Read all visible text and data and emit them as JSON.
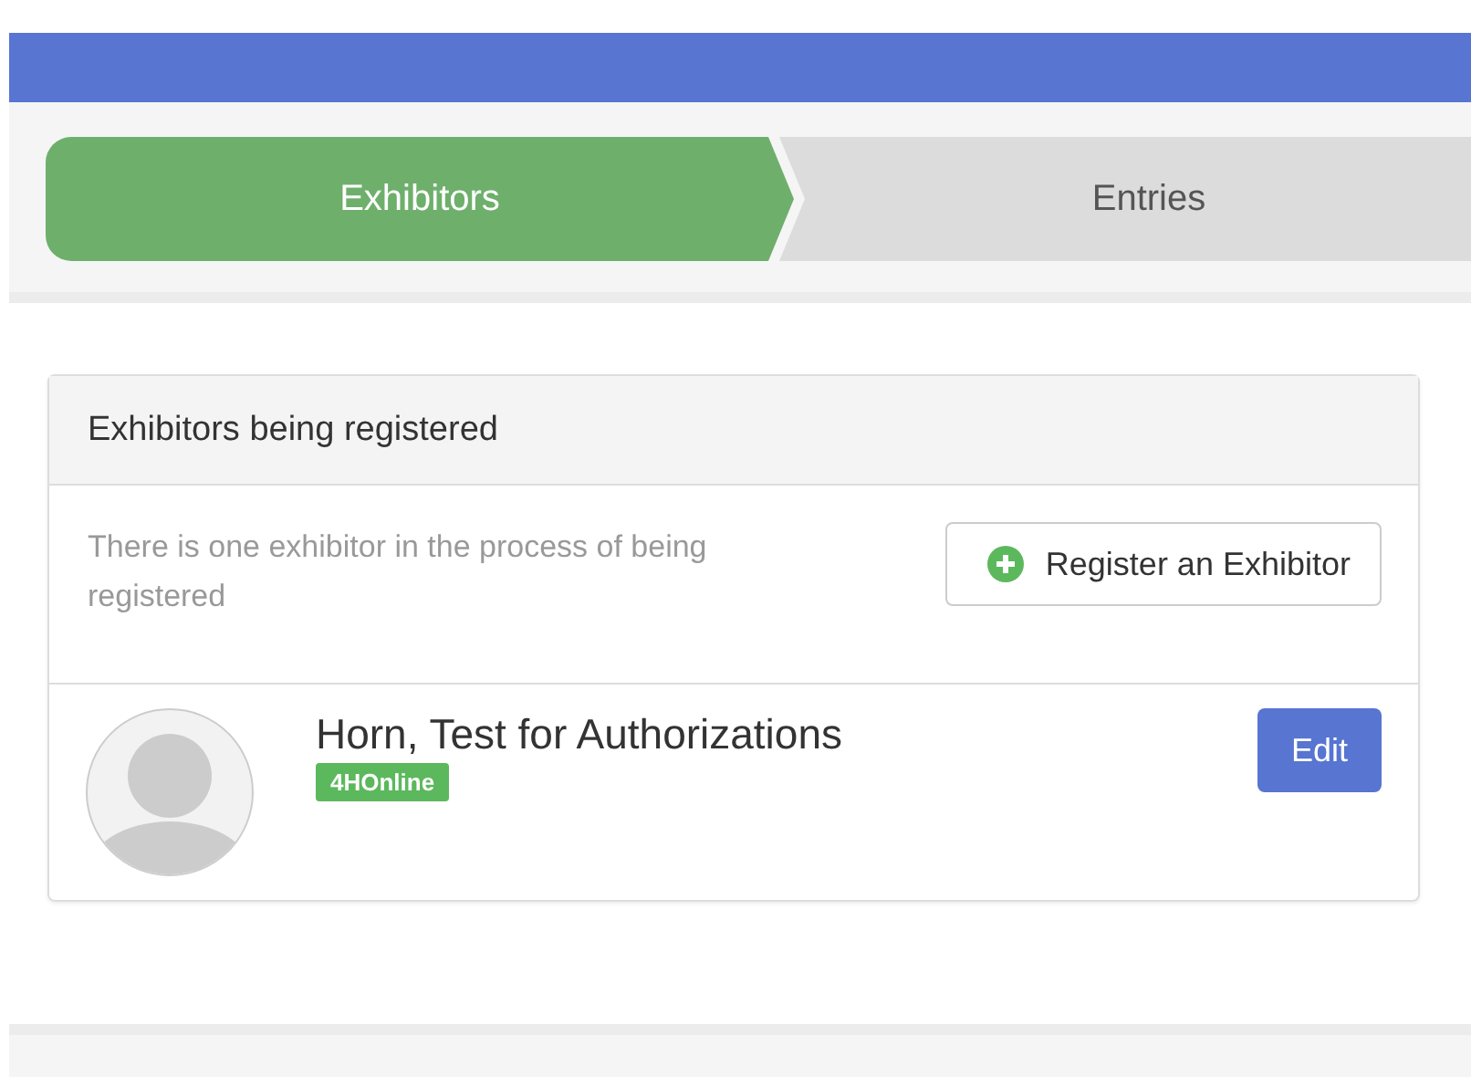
{
  "steps": [
    {
      "label": "Exhibitors",
      "selected": true
    },
    {
      "label": "Entries",
      "selected": false
    }
  ],
  "panel": {
    "title": "Exhibitors being registered",
    "message": "There is one exhibitor in the process of being registered",
    "register_button": "Register an Exhibitor",
    "exhibitors": [
      {
        "name": "Horn, Test for Authorizations",
        "source": "4HOnline",
        "edit_button": "Edit"
      }
    ]
  }
}
